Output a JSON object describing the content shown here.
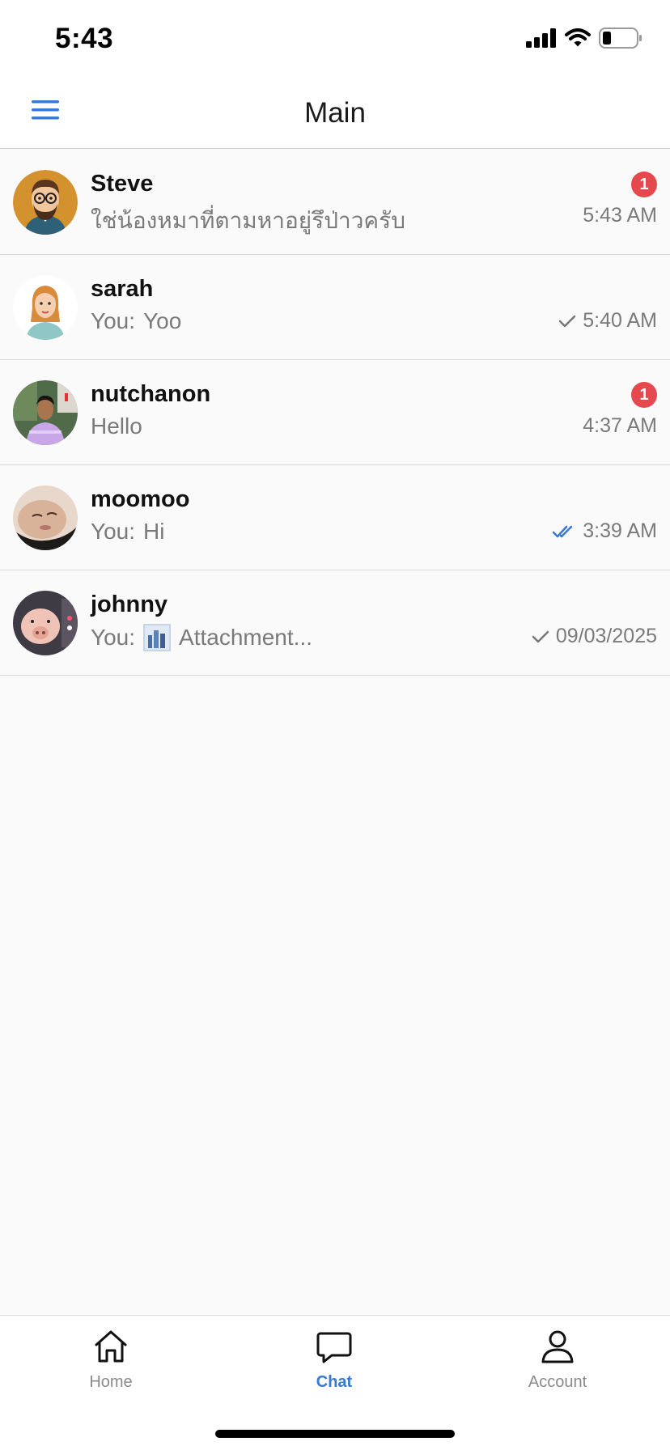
{
  "status_bar": {
    "time": "5:43"
  },
  "header": {
    "title": "Main"
  },
  "chats": [
    {
      "name": "Steve",
      "preview": "ใช่น้องหมาที่ตามหาอยู่รึป่าวครับ",
      "time": "5:43 AM",
      "unread": "1",
      "status": "none",
      "avatar": "cartoon-man"
    },
    {
      "name": "sarah",
      "preview_prefix": "You:",
      "preview": "Yoo",
      "time": "5:40 AM",
      "status": "sent",
      "avatar": "cartoon-woman"
    },
    {
      "name": "nutchanon",
      "preview": "Hello",
      "time": "4:37 AM",
      "unread": "1",
      "status": "none",
      "avatar": "photo-person"
    },
    {
      "name": "moomoo",
      "preview_prefix": "You:",
      "preview": "Hi",
      "time": "3:39 AM",
      "status": "read",
      "avatar": "photo-face"
    },
    {
      "name": "johnny",
      "preview_prefix": "You:",
      "preview": "Attachment...",
      "time": "09/03/2025",
      "status": "sent",
      "avatar": "photo-pig"
    }
  ],
  "nav": {
    "home": "Home",
    "chat": "Chat",
    "account": "Account"
  },
  "colors": {
    "accent": "#3a78d6",
    "badge": "#e5484d",
    "read_check": "#3a78d6"
  }
}
